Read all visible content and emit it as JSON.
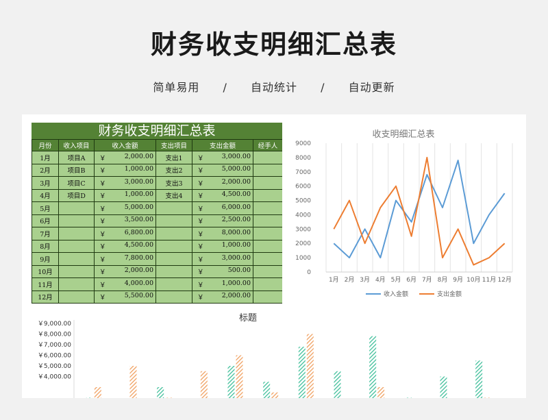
{
  "header": {
    "title": "财务收支明细汇总表",
    "subtitle": [
      "简单易用",
      "/",
      "自动统计",
      "/",
      "自动更新"
    ]
  },
  "sheet": {
    "title": "财务收支明细汇总表",
    "columns": [
      "月份",
      "收入项目",
      "收入金额",
      "支出项目",
      "支出金额",
      "经手人"
    ],
    "currency": "￥",
    "rows": [
      {
        "month": "1月",
        "income_item": "项目A",
        "income": "2,000.00",
        "expense_item": "支出1",
        "expense": "3,000.00",
        "handler": ""
      },
      {
        "month": "2月",
        "income_item": "项目B",
        "income": "1,000.00",
        "expense_item": "支出2",
        "expense": "5,000.00",
        "handler": ""
      },
      {
        "month": "3月",
        "income_item": "项目C",
        "income": "3,000.00",
        "expense_item": "支出3",
        "expense": "2,000.00",
        "handler": ""
      },
      {
        "month": "4月",
        "income_item": "项目D",
        "income": "1,000.00",
        "expense_item": "支出4",
        "expense": "4,500.00",
        "handler": ""
      },
      {
        "month": "5月",
        "income_item": "",
        "income": "5,000.00",
        "expense_item": "",
        "expense": "6,000.00",
        "handler": ""
      },
      {
        "month": "6月",
        "income_item": "",
        "income": "3,500.00",
        "expense_item": "",
        "expense": "2,500.00",
        "handler": ""
      },
      {
        "month": "7月",
        "income_item": "",
        "income": "6,800.00",
        "expense_item": "",
        "expense": "8,000.00",
        "handler": ""
      },
      {
        "month": "8月",
        "income_item": "",
        "income": "4,500.00",
        "expense_item": "",
        "expense": "1,000.00",
        "handler": ""
      },
      {
        "month": "9月",
        "income_item": "",
        "income": "7,800.00",
        "expense_item": "",
        "expense": "3,000.00",
        "handler": ""
      },
      {
        "month": "10月",
        "income_item": "",
        "income": "2,000.00",
        "expense_item": "",
        "expense": "500.00",
        "handler": ""
      },
      {
        "month": "11月",
        "income_item": "",
        "income": "4,000.00",
        "expense_item": "",
        "expense": "1,000.00",
        "handler": ""
      },
      {
        "month": "12月",
        "income_item": "",
        "income": "5,500.00",
        "expense_item": "",
        "expense": "2,000.00",
        "handler": ""
      }
    ]
  },
  "colors": {
    "income": "#5b9bd5",
    "expense": "#ed7d31",
    "bar_green": "#3fbf9a",
    "bar_orange": "#f0a060",
    "sheet_dark": "#548235",
    "sheet_light": "#a9d08e"
  },
  "chart_data": [
    {
      "type": "line",
      "title": "收支明细汇总表",
      "categories": [
        "1月",
        "2月",
        "3月",
        "4月",
        "5月",
        "6月",
        "7月",
        "8月",
        "9月",
        "10月",
        "11月",
        "12月"
      ],
      "y_ticks": [
        "0",
        "1000",
        "2000",
        "3000",
        "4000",
        "5000",
        "6000",
        "7000",
        "8000",
        "9000"
      ],
      "ylim": [
        0,
        9000
      ],
      "grid": "vertical",
      "legend": "bottom",
      "series": [
        {
          "name": "收入金额",
          "values": [
            2000,
            1000,
            3000,
            1000,
            5000,
            3500,
            6800,
            4500,
            7800,
            2000,
            4000,
            5500
          ]
        },
        {
          "name": "支出金额",
          "values": [
            3000,
            5000,
            2000,
            4500,
            6000,
            2500,
            8000,
            1000,
            3000,
            500,
            1000,
            2000
          ]
        }
      ]
    },
    {
      "type": "bar",
      "title": "标题",
      "y_ticks": [
        "￥9,000.00",
        "￥8,000.00",
        "￥7,000.00",
        "￥6,000.00",
        "￥5,000.00",
        "￥4,000.00"
      ],
      "ylim": [
        3000,
        9000
      ],
      "series": [
        {
          "values": [
            2000,
            1000,
            3000,
            1000,
            5000,
            3500,
            6800,
            4500,
            7800,
            2000,
            4000,
            5500
          ]
        },
        {
          "values": [
            3000,
            5000,
            2000,
            4500,
            6000,
            2500,
            8000,
            1000,
            3000,
            500,
            1000,
            2000
          ]
        }
      ]
    }
  ]
}
